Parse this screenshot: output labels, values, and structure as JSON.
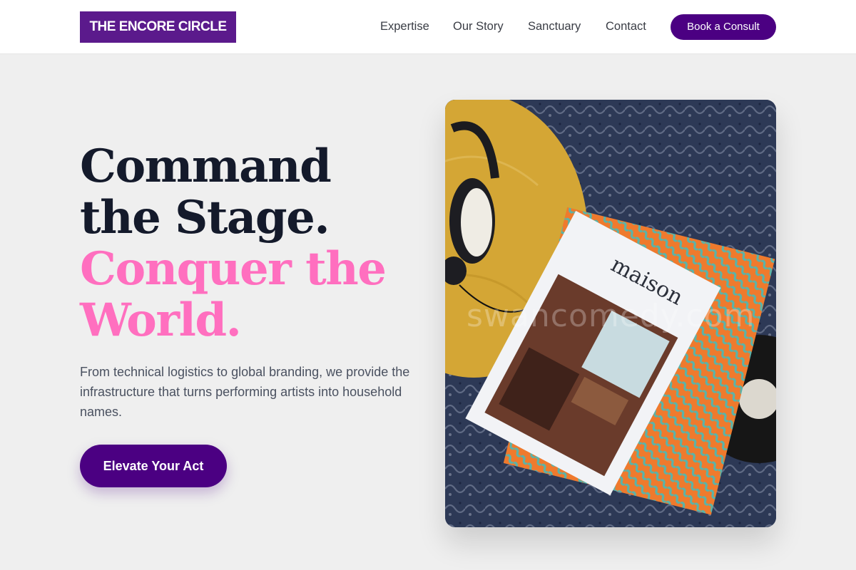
{
  "header": {
    "logo_text": "THE ENCORE CIRCLE",
    "nav": [
      {
        "label": "Expertise"
      },
      {
        "label": "Our Story"
      },
      {
        "label": "Sanctuary"
      },
      {
        "label": "Contact"
      }
    ],
    "cta_label": "Book a Consult"
  },
  "hero": {
    "title_line1": "Command",
    "title_line2": "the Stage.",
    "title_line3": "Conquer the",
    "title_line4": "World.",
    "subtitle": "From technical logistics to global branding, we provide the infrastructure that turns performing artists into household names.",
    "cta_label": "Elevate Your Act",
    "image": {
      "magazine_title": "maison",
      "watermark": "swancomedy.com"
    }
  },
  "colors": {
    "brand_purple": "#4b0082",
    "logo_purple": "#5b1a8c",
    "headline_dark": "#141a2b",
    "headline_pink": "#ff6fbf",
    "page_bg": "#efefef"
  }
}
